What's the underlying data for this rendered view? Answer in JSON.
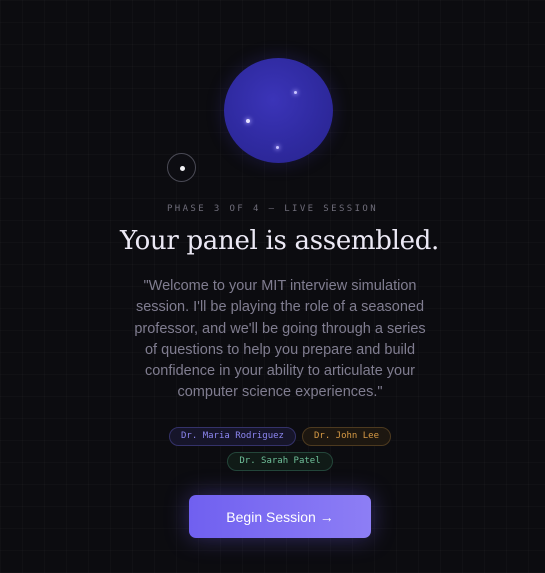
{
  "header": {
    "phase_label": "PHASE 3 OF 4 — LIVE SESSION",
    "title": "Your panel is assembled."
  },
  "intro": {
    "quote": "\"Welcome to your MIT interview simulation session. I'll be playing the role of a seasoned professor, and we'll be going through a series of questions to help you prepare and build confidence in your ability to articulate your computer science experiences.\""
  },
  "panel": {
    "members": [
      {
        "name": "Dr. Maria Rodriguez",
        "color": "#8c86f0"
      },
      {
        "name": "Dr. John Lee",
        "color": "#d79a45"
      },
      {
        "name": "Dr. Sarah Patel",
        "color": "#6fbf99"
      }
    ]
  },
  "actions": {
    "begin_label": "Begin Session →"
  },
  "theme": {
    "accent": "#7c6cf2",
    "orb": "#2f2aa0",
    "background": "#0c0c10"
  }
}
